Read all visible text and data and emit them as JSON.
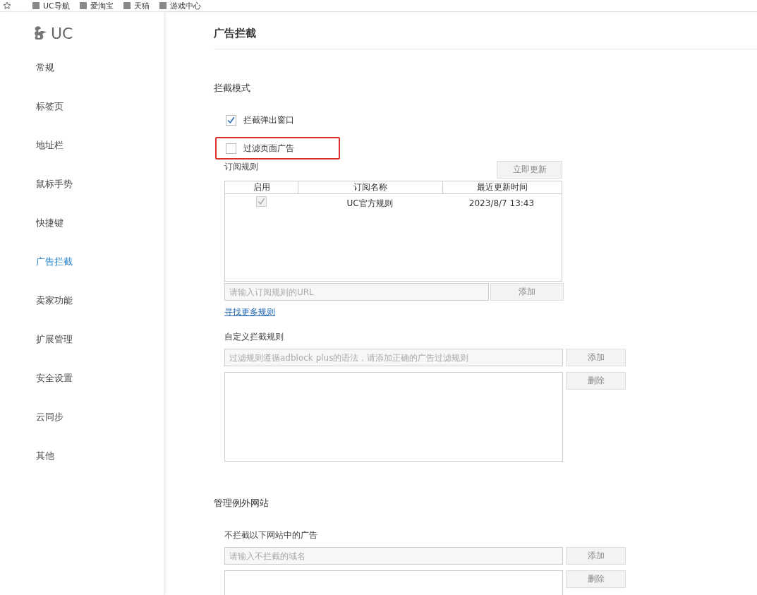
{
  "bookmarks": [
    {
      "label": "UC导航"
    },
    {
      "label": "爱淘宝"
    },
    {
      "label": "天猫"
    },
    {
      "label": "游戏中心"
    }
  ],
  "sidebar": {
    "items": [
      {
        "label": "常规",
        "selected": false
      },
      {
        "label": "标签页",
        "selected": false
      },
      {
        "label": "地址栏",
        "selected": false
      },
      {
        "label": "鼠标手势",
        "selected": false
      },
      {
        "label": "快捷键",
        "selected": false
      },
      {
        "label": "广告拦截",
        "selected": true
      },
      {
        "label": "卖家功能",
        "selected": false
      },
      {
        "label": "扩展管理",
        "selected": false
      },
      {
        "label": "安全设置",
        "selected": false
      },
      {
        "label": "云同步",
        "selected": false
      },
      {
        "label": "其他",
        "selected": false
      }
    ]
  },
  "logo_text": "UC",
  "page_title": "广告拦截",
  "block_mode": {
    "heading": "拦截模式",
    "options": [
      {
        "label": "拦截弹出窗口",
        "checked": true,
        "highlighted": false
      },
      {
        "label": "过滤页面广告",
        "checked": false,
        "highlighted": true
      }
    ]
  },
  "subscriptions": {
    "heading": "订阅规则",
    "update_button": "立即更新",
    "columns": [
      "启用",
      "订阅名称",
      "最近更新时间"
    ],
    "rows": [
      {
        "enabled": true,
        "name": "UC官方规则",
        "updated": "2023/8/7 13:43"
      }
    ],
    "url_placeholder": "请输入订阅规则的URL",
    "add_button": "添加",
    "more_link": "寻找更多规则"
  },
  "custom_rules": {
    "heading": "自定义拦截规则",
    "placeholder": "过滤规则遵循adblock plus的语法，请添加正确的广告过滤规则",
    "add_button": "添加",
    "delete_button": "删除"
  },
  "exceptions": {
    "heading": "管理例外网站",
    "subheading": "不拦截以下网站中的广告",
    "placeholder": "请输入不拦截的域名",
    "add_button": "添加",
    "delete_button": "删除"
  }
}
